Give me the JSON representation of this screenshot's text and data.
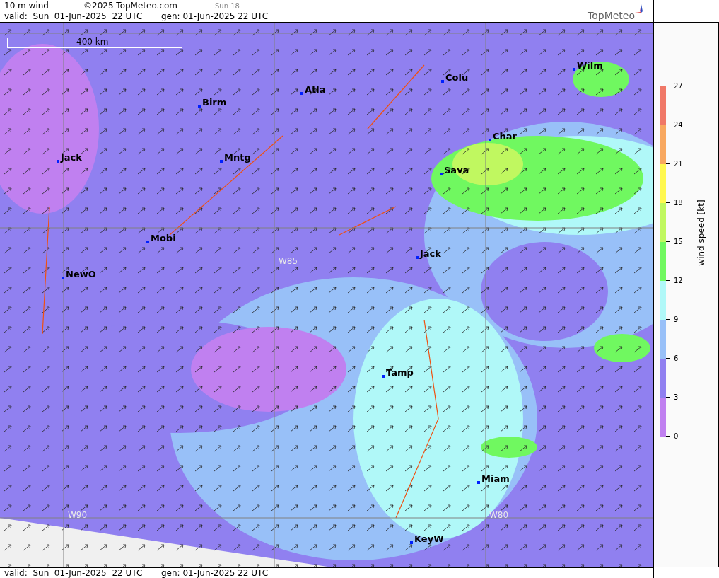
{
  "header": {
    "title": "10 m wind",
    "copyright": "©2025 TopMeteo.com",
    "step": "Sun 18",
    "valid": "valid:  Sun  01-Jun-2025  22 UTC",
    "generated": "gen: 01-Jun-2025 22 UTC",
    "logo": "TopMeteo"
  },
  "map": {
    "scale": "400 km",
    "cities": [
      "Birm",
      "Atla",
      "Colu",
      "Wilm",
      "Jack",
      "Mntg",
      "Char",
      "Sava",
      "Mobi",
      "Jack",
      "NewO",
      "Tamp",
      "Miam",
      "KeyW"
    ],
    "grid_labels": [
      "W85",
      "W90",
      "W80"
    ]
  },
  "legend": {
    "title": "wind speed [kt]",
    "ticks": [
      "27",
      "24",
      "21",
      "18",
      "15",
      "12",
      "9",
      "6",
      "3",
      "0"
    ],
    "bands": [
      {
        "color": "#f07868"
      },
      {
        "color": "#f8a860"
      },
      {
        "color": "#fff850"
      },
      {
        "color": "#c0f860"
      },
      {
        "color": "#70f860"
      },
      {
        "color": "#b0f8f8"
      },
      {
        "color": "#98c0f8"
      },
      {
        "color": "#9080f0"
      },
      {
        "color": "#c080f0"
      }
    ]
  },
  "footer": {
    "valid": "valid:  Sun  01-Jun-2025  22 UTC",
    "generated": "gen: 01-Jun-2025 22 UTC"
  }
}
